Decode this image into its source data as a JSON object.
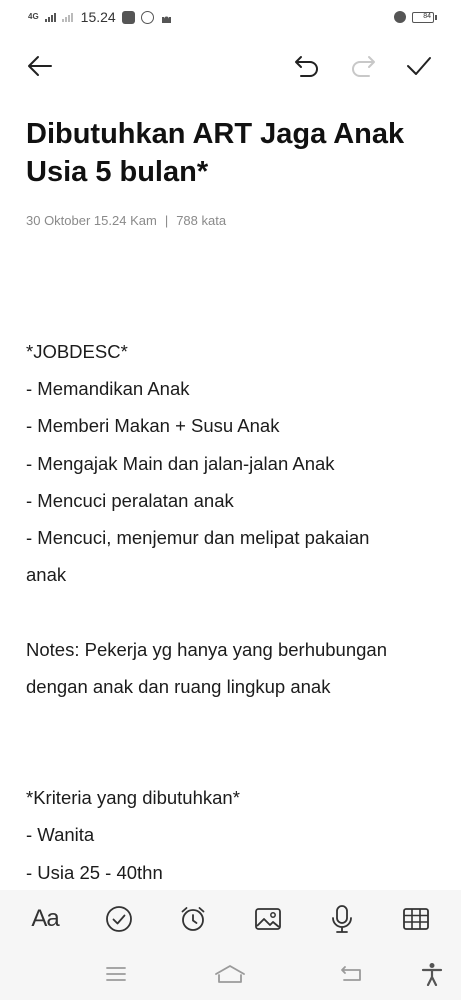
{
  "status_bar": {
    "network": "4G",
    "time": "15.24",
    "battery_level": "84"
  },
  "toolbar": {
    "back": "back-arrow-icon",
    "undo": "undo-icon",
    "redo": "redo-icon",
    "done": "checkmark-icon"
  },
  "note": {
    "title": "Dibutuhkan ART Jaga Anak Usia 5 bulan*",
    "date": "30 Oktober 15.24 Kam",
    "separator": "|",
    "word_count": "788 kata",
    "lines": [
      "*JOBDESC*",
      "- Memandikan Anak",
      "- Memberi Makan + Susu Anak",
      "- Mengajak Main dan jalan-jalan Anak",
      "- Mencuci peralatan anak",
      "- Mencuci, menjemur dan melipat pakaian",
      "anak",
      "",
      "Notes: Pekerja yg hanya yang berhubungan",
      "dengan anak dan ruang lingkup anak",
      "",
      "",
      "*Kriteria yang dibutuhkan*",
      "- Wanita",
      "- Usia 25 - 40thn"
    ]
  },
  "editor_bar": {
    "text_format_label": "Aa",
    "icons": [
      "checklist-icon",
      "alarm-clock-icon",
      "image-icon",
      "microphone-icon",
      "table-icon"
    ]
  },
  "nav_bar": {
    "icons": [
      "menu-icon",
      "home-icon",
      "back-icon",
      "accessibility-icon"
    ]
  },
  "colors": {
    "background": "#ffffff",
    "text": "#1c1c1c",
    "meta_text": "#8a8a8a",
    "toolbar_bg": "#f6f6f6",
    "disabled_icon": "#c8c8c8"
  }
}
